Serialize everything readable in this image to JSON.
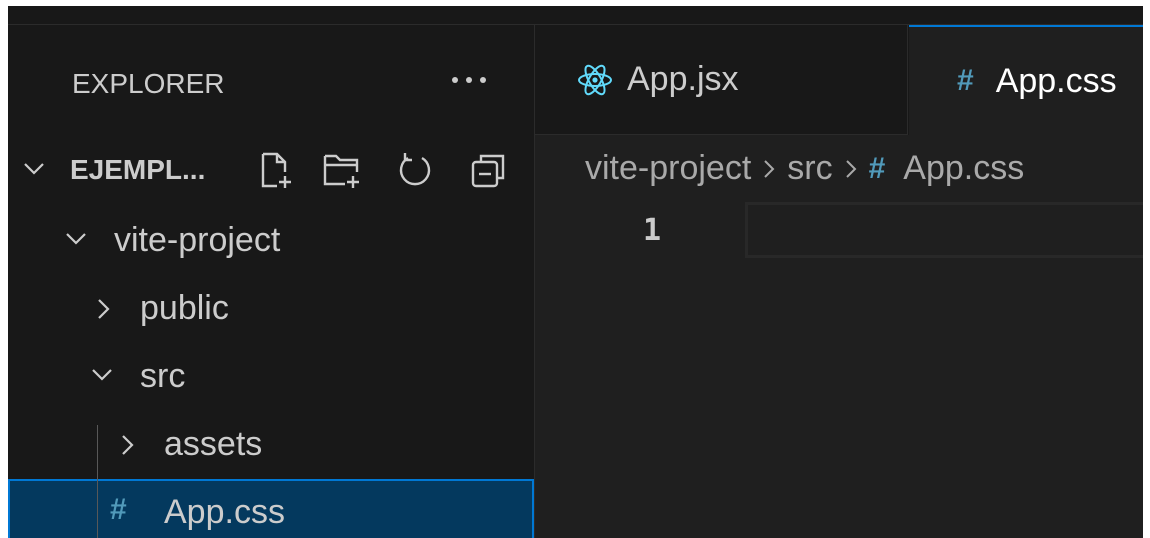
{
  "sidebar": {
    "title": "EXPLORER",
    "section_title": "EJEMPL...",
    "tree": [
      {
        "label": "vite-project",
        "expanded": true
      },
      {
        "label": "public",
        "expanded": false
      },
      {
        "label": "src",
        "expanded": true
      },
      {
        "label": "assets",
        "expanded": false
      },
      {
        "label": "App.css",
        "selected": true,
        "icon": "hash-icon"
      }
    ],
    "file_icon_glyph": "#"
  },
  "tabs": [
    {
      "label": "App.jsx",
      "icon": "react-icon",
      "active": false
    },
    {
      "label": "App.css",
      "icon": "hash-icon",
      "icon_glyph": "#",
      "active": true
    }
  ],
  "breadcrumb": {
    "items": [
      "vite-project",
      "src",
      "App.css"
    ],
    "file_glyph": "#"
  },
  "editor": {
    "line_number": "1"
  },
  "colors": {
    "accent": "#0078d4",
    "selection": "#04395e",
    "css_icon": "#519aba",
    "react_icon": "#61dafb"
  }
}
